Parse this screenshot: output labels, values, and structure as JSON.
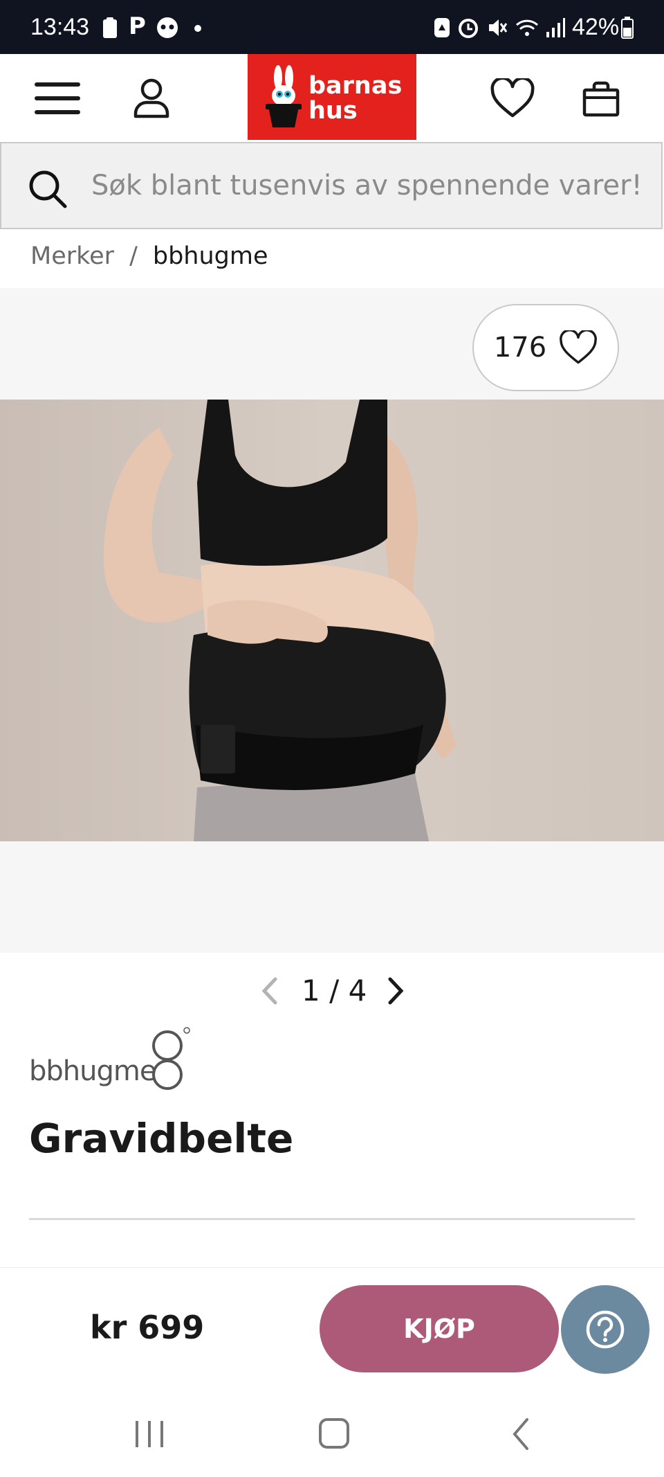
{
  "status_bar": {
    "time": "13:43",
    "battery": "42%",
    "icons": [
      "clipboard-icon",
      "parking-icon",
      "face-icon",
      "dot-icon",
      "recycle-icon",
      "alarm-icon",
      "mute-icon",
      "wifi-icon",
      "signal-icon",
      "battery-icon"
    ]
  },
  "header": {
    "logo_line1": "barnas",
    "logo_line2": "hus",
    "icons": [
      "menu-icon",
      "user-icon",
      "heart-icon",
      "bag-icon"
    ],
    "brand_color": "#e3221d"
  },
  "search": {
    "placeholder": "Søk blant tusenvis av spennende varer!"
  },
  "breadcrumb": {
    "root": "Merker",
    "separator": "/",
    "current": "bbhugme"
  },
  "gallery": {
    "favorites_count": "176",
    "pager": "1 / 4"
  },
  "product": {
    "brand": "bbhugme",
    "title": "Gravidbelte",
    "price": "kr 699",
    "buy_label": "KJØP",
    "buy_color": "#ad5a79",
    "help_color": "#6b8aa0"
  }
}
